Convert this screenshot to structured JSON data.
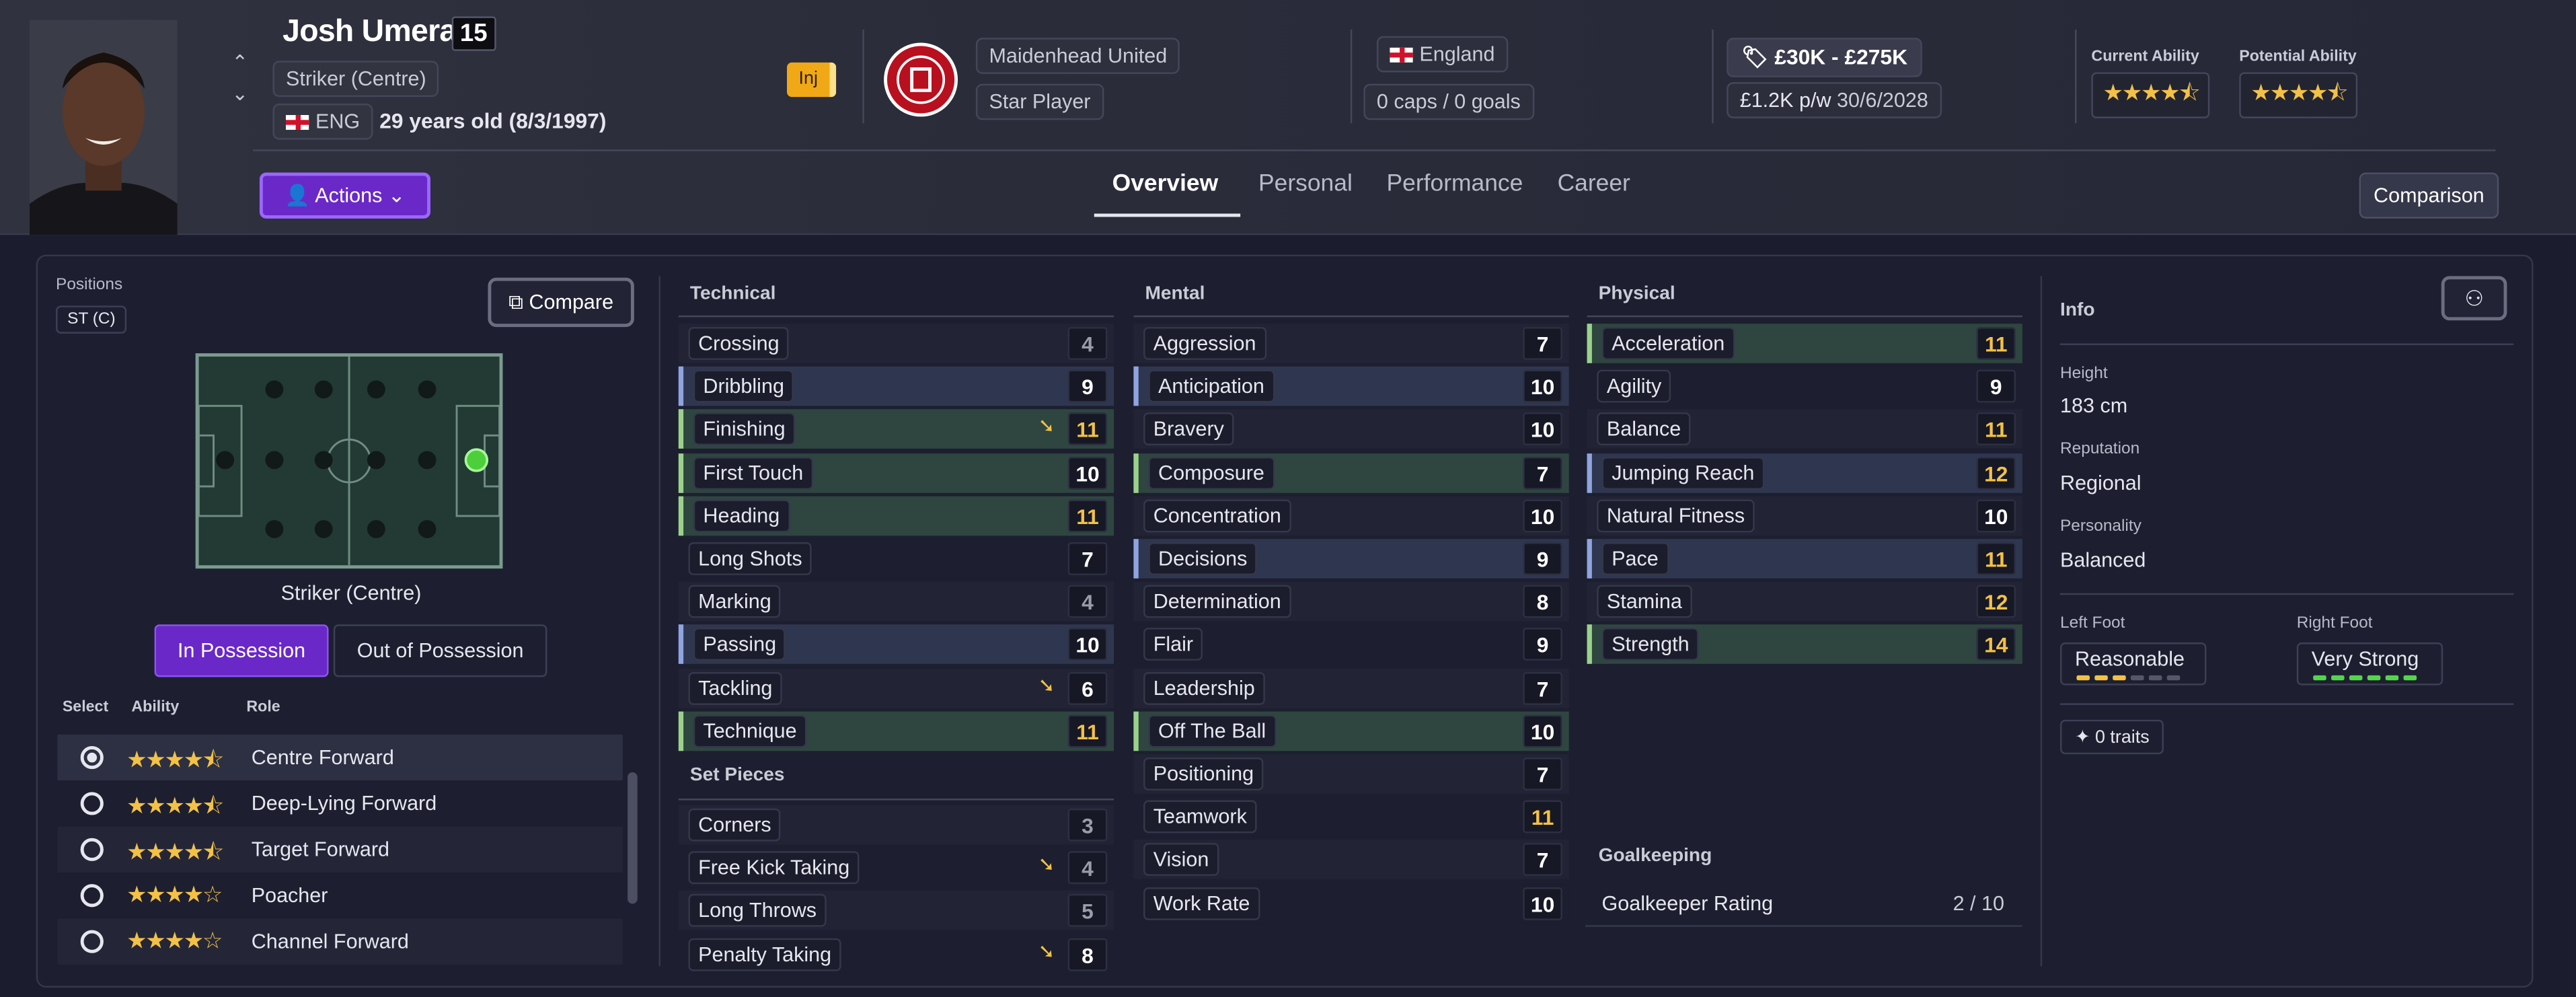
{
  "player": {
    "name": "Josh Umerah",
    "number": "15",
    "position": "Striker (Centre)",
    "nation_code": "ENG",
    "age": "29 years old (8/3/1997)",
    "injury_badge": "Inj"
  },
  "club": {
    "name": "Maidenhead United",
    "status": "Star Player"
  },
  "international": {
    "country": "England",
    "caps": "0 caps / 0 goals"
  },
  "contract": {
    "value": "£30K - £275K",
    "wage": "£1.2K p/w",
    "expiry": "30/6/2028"
  },
  "abilities": {
    "current_label": "Current Ability",
    "current_stars": 4.5,
    "potential_label": "Potential Ability",
    "potential_stars": 4.5
  },
  "nav": {
    "actions": "Actions",
    "tabs": [
      "Overview",
      "Personal",
      "Performance",
      "Career"
    ],
    "comparison": "Comparison"
  },
  "positions": {
    "label": "Positions",
    "chip": "ST (C)",
    "compare": "Compare",
    "current": "Striker (Centre)",
    "toggle_on": "In Possession",
    "toggle_off": "Out of Possession",
    "headers": [
      "Select",
      "Ability",
      "Role"
    ],
    "roles": [
      {
        "name": "Centre Forward",
        "stars": "★★★★⯪",
        "selected": true
      },
      {
        "name": "Deep-Lying Forward",
        "stars": "★★★★⯪",
        "selected": false
      },
      {
        "name": "Target Forward",
        "stars": "★★★★⯪",
        "selected": false
      },
      {
        "name": "Poacher",
        "stars": "★★★★☆",
        "selected": false
      },
      {
        "name": "Channel Forward",
        "stars": "★★★★☆",
        "selected": false
      }
    ]
  },
  "technical": {
    "title": "Technical",
    "attrs": [
      {
        "name": "Crossing",
        "value": "4"
      },
      {
        "name": "Dribbling",
        "value": "9"
      },
      {
        "name": "Finishing",
        "value": "11",
        "trend": true
      },
      {
        "name": "First Touch",
        "value": "10"
      },
      {
        "name": "Heading",
        "value": "11"
      },
      {
        "name": "Long Shots",
        "value": "7"
      },
      {
        "name": "Marking",
        "value": "4"
      },
      {
        "name": "Passing",
        "value": "10"
      },
      {
        "name": "Tackling",
        "value": "6",
        "trend": true
      },
      {
        "name": "Technique",
        "value": "11"
      }
    ]
  },
  "setpieces": {
    "title": "Set Pieces",
    "attrs": [
      {
        "name": "Corners",
        "value": "3"
      },
      {
        "name": "Free Kick Taking",
        "value": "4",
        "trend": true
      },
      {
        "name": "Long Throws",
        "value": "5"
      },
      {
        "name": "Penalty Taking",
        "value": "8",
        "trend": true
      }
    ]
  },
  "mental": {
    "title": "Mental",
    "attrs": [
      {
        "name": "Aggression",
        "value": "7"
      },
      {
        "name": "Anticipation",
        "value": "10"
      },
      {
        "name": "Bravery",
        "value": "10"
      },
      {
        "name": "Composure",
        "value": "7"
      },
      {
        "name": "Concentration",
        "value": "10"
      },
      {
        "name": "Decisions",
        "value": "9"
      },
      {
        "name": "Determination",
        "value": "8"
      },
      {
        "name": "Flair",
        "value": "9"
      },
      {
        "name": "Leadership",
        "value": "7"
      },
      {
        "name": "Off The Ball",
        "value": "10"
      },
      {
        "name": "Positioning",
        "value": "7"
      },
      {
        "name": "Teamwork",
        "value": "11"
      },
      {
        "name": "Vision",
        "value": "7"
      },
      {
        "name": "Work Rate",
        "value": "10"
      }
    ]
  },
  "physical": {
    "title": "Physical",
    "attrs": [
      {
        "name": "Acceleration",
        "value": "11"
      },
      {
        "name": "Agility",
        "value": "9"
      },
      {
        "name": "Balance",
        "value": "11"
      },
      {
        "name": "Jumping Reach",
        "value": "12"
      },
      {
        "name": "Natural Fitness",
        "value": "10"
      },
      {
        "name": "Pace",
        "value": "11"
      },
      {
        "name": "Stamina",
        "value": "12"
      },
      {
        "name": "Strength",
        "value": "14"
      }
    ]
  },
  "goalkeeping": {
    "title": "Goalkeeping",
    "label": "Goalkeeper Rating",
    "value": "2 / 10"
  },
  "info": {
    "title": "Info",
    "height_label": "Height",
    "height": "183 cm",
    "reputation_label": "Reputation",
    "reputation": "Regional",
    "personality_label": "Personality",
    "personality": "Balanced",
    "left_foot_label": "Left Foot",
    "left_foot": "Reasonable",
    "left_foot_level": 3,
    "right_foot_label": "Right Foot",
    "right_foot": "Very Strong",
    "right_foot_level": 6,
    "traits": "0 traits"
  },
  "colors": {
    "accent": "#6a28c8",
    "highlight_value": "#f3c145",
    "low_value": "#9a9cab",
    "row_green": "#2f4640",
    "row_blue": "#2f3650"
  }
}
